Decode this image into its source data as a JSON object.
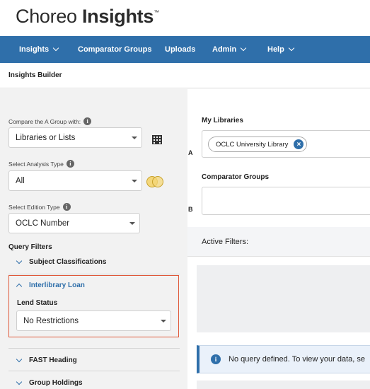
{
  "brand": {
    "name_light": "Choreo ",
    "name_bold": "Insights",
    "tm": "™"
  },
  "nav": {
    "items": [
      {
        "label": "Insights",
        "dropdown": true
      },
      {
        "label": "Comparator Groups",
        "dropdown": false
      },
      {
        "label": "Uploads",
        "dropdown": false
      },
      {
        "label": "Admin",
        "dropdown": true
      },
      {
        "label": "Help",
        "dropdown": true
      }
    ]
  },
  "subheader": {
    "title": "Insights Builder"
  },
  "left": {
    "compare": {
      "label": "Compare the A Group with:",
      "info": "i",
      "value": "Libraries or Lists",
      "icon": "building-icon"
    },
    "analysis": {
      "label": "Select Analysis Type",
      "info": "i",
      "value": "All",
      "icon": "venn-icon"
    },
    "edition": {
      "label": "Select Edition Type",
      "info": "i",
      "value": "OCLC Number"
    },
    "query_filters": {
      "title": "Query Filters",
      "subject": "Subject Classifications",
      "interlibrary": "Interlibrary Loan",
      "lend_status_label": "Lend Status",
      "lend_status_value": "No Restrictions",
      "fast": "FAST Heading",
      "group_holdings": "Group Holdings"
    },
    "highlight_color": "#e0593a"
  },
  "right": {
    "my_libraries": {
      "label": "My Libraries",
      "letter": "A",
      "chip": "OCLC University Library",
      "chip_remove": "×"
    },
    "comparator": {
      "label": "Comparator Groups",
      "letter": "B"
    },
    "active_filters": "Active Filters:",
    "notice": {
      "icon": "i",
      "text": "No query defined. To view your data, se"
    }
  },
  "colors": {
    "nav_bg": "#2f6faa",
    "accent": "#2f6faa"
  }
}
